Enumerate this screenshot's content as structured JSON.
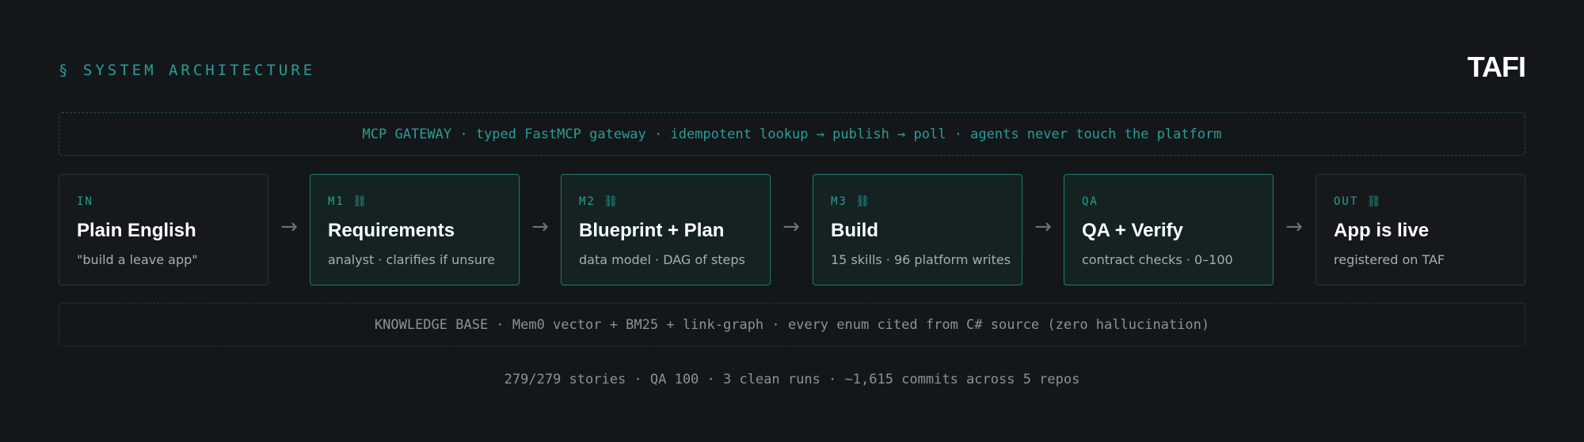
{
  "header": {
    "section_title": "§ SYSTEM ARCHITECTURE",
    "logo": "TAFI"
  },
  "gateway": {
    "text": "MCP GATEWAY · typed FastMCP gateway · idempotent lookup → publish → poll · agents never touch the platform"
  },
  "stages": [
    {
      "tag": "IN",
      "title": "Plain English",
      "desc": "\"build a leave app\""
    },
    {
      "tag": "M1 ⛓",
      "title": "Requirements",
      "desc": "analyst · clarifies if unsure"
    },
    {
      "tag": "M2 ⛓",
      "title": "Blueprint + Plan",
      "desc": "data model · DAG of steps"
    },
    {
      "tag": "M3 ⛓",
      "title": "Build",
      "desc": "15 skills · 96 platform writes"
    },
    {
      "tag": "QA",
      "title": "QA + Verify",
      "desc": "contract checks · 0–100"
    },
    {
      "tag": "OUT ⛓",
      "title": "App is live",
      "desc": "registered on TAF"
    }
  ],
  "arrow_glyph": "→",
  "knowledge_base": {
    "text": "KNOWLEDGE BASE · Mem0 vector + BM25 + link-graph · every enum cited from C# source (zero hallucination)"
  },
  "footer": {
    "text": "279/279 stories · QA 100 · 3 clean runs · ~1,615 commits across 5 repos"
  },
  "colors": {
    "background": "#13171a",
    "accent": "#2a9d95",
    "active_border": "#1f7a70"
  }
}
